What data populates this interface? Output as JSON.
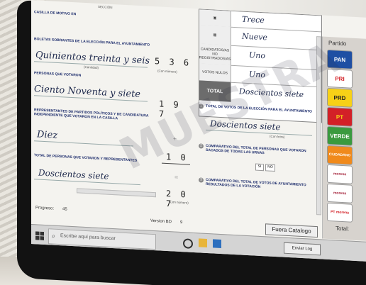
{
  "form": {
    "header_cut": "SECCIÓN",
    "seal_label": "CASILLA DE MOTIVO EN",
    "sect1_title": "BOLETAS SOBRANTES DE LA ELECCIÓN PARA EL AYUNTAMIENTO",
    "sect1_written": "Quinientos treinta y seis",
    "sect1_caption_letter": "(Con letra)",
    "sect1_caption_number": "(Cantidad)",
    "sect1_number": "5 3 6",
    "sect1_number_caption": "(Con número)",
    "sect2_title": "PERSONAS QUE VOTARON",
    "sect2_written": "Ciento Noventa y siete",
    "sect2_number": "1 9 7",
    "sect3_title": "REPRESENTANTES DE PARTIDOS POLÍTICOS Y DE CANDIDATURA INDEPENDIENTE QUE VOTARON EN LA CASILLA",
    "sect3_written": "Diez",
    "sect3_number": "1 0",
    "plus": "+",
    "equals": "=",
    "sect4_title": "TOTAL DE PERSONAS QUE VOTARON Y REPRESENTANTES",
    "sect4_written": "Doscientos siete",
    "sect4_number": "2 0 7",
    "number_caption": "(Con número)"
  },
  "table": {
    "rows": [
      {
        "label": "",
        "value": "Trece"
      },
      {
        "label": "",
        "value": "Nueve"
      },
      {
        "label": "CANDIDATOS/AS NO REGISTRADOS/AS",
        "value": "Uno"
      },
      {
        "label": "VOTOS NULOS",
        "value": "Uno"
      },
      {
        "label": "TOTAL",
        "value": "Doscientos siete"
      }
    ]
  },
  "mid": {
    "q1_title": "TOTAL DE VOTOS DE LA ELECCIÓN PARA EL AYUNTAMIENTO",
    "q1_written": "Doscientos siete",
    "q1_caption": "(Con letra)",
    "q2_title": "COMPARATIVO DEL TOTAL DE PERSONAS QUE VOTARON SACADOS DE TODAS LAS URNAS",
    "q2_yes": "SI",
    "q2_no": "NO",
    "q3_title": "COMPARATIVO DEL TOTAL DE VOTOS DE AYUNTAMIENTO RESULTADOS DE LA VOTACIÓN"
  },
  "sidebar": {
    "header": "Partido",
    "parties": [
      {
        "name": "PAN",
        "bg": "#1f4fa3",
        "fg": "#ffffff"
      },
      {
        "name": "PRI",
        "bg": "#ffffff",
        "fg": "#d32027"
      },
      {
        "name": "PRD",
        "bg": "#f7d117",
        "fg": "#222222"
      },
      {
        "name": "PT",
        "bg": "#d32027",
        "fg": "#f7d117"
      },
      {
        "name": "VERDE",
        "bg": "#3a9a3e",
        "fg": "#ffffff"
      },
      {
        "name": "CIUDADANO",
        "bg": "#f08a1c",
        "fg": "#ffffff"
      },
      {
        "name": "morena",
        "bg": "#ffffff",
        "fg": "#a5243c"
      },
      {
        "name": "morena",
        "bg": "#ffffff",
        "fg": "#a5243c"
      },
      {
        "name": "PT morena",
        "bg": "#ffffff",
        "fg": "#d32027"
      }
    ],
    "total_label": "Total:"
  },
  "footer": {
    "progress_label": "Progreso:",
    "progress_value": "45",
    "version_label": "Version BD",
    "version_value": "9",
    "catalog_button": "Fuera Catalogo",
    "send_log_button": "Enviar Log"
  },
  "taskbar": {
    "search_placeholder": "Escribe aquí para buscar"
  },
  "watermark": "MUESTRA"
}
